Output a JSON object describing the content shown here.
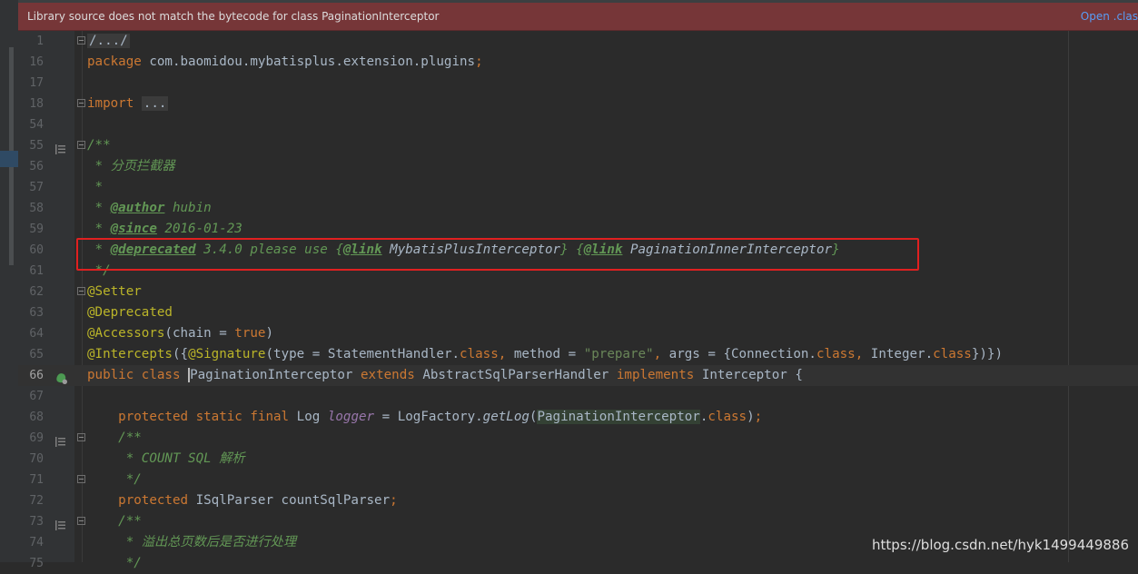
{
  "banner": {
    "message": "Library source does not match the bytecode for class PaginationInterceptor",
    "action": "Open .clas"
  },
  "lines": [
    {
      "num": "1",
      "fold": true,
      "text": "/.../"
    },
    {
      "num": "16",
      "text": "package com.baomidou.mybatisplus.extension.plugins;"
    },
    {
      "num": "17",
      "text": ""
    },
    {
      "num": "18",
      "fold": true,
      "text": "import ..."
    },
    {
      "num": "54",
      "text": ""
    },
    {
      "num": "55",
      "gutter": "doc-icon",
      "fold": true,
      "text": "/**"
    },
    {
      "num": "56",
      "text": " * 分页拦截器"
    },
    {
      "num": "57",
      "text": " *"
    },
    {
      "num": "58",
      "text": " * @author hubin"
    },
    {
      "num": "59",
      "text": " * @since 2016-01-23"
    },
    {
      "num": "60",
      "text": " * @deprecated 3.4.0 please use {@link MybatisPlusInterceptor} {@link PaginationInnerInterceptor}"
    },
    {
      "num": "61",
      "text": " */"
    },
    {
      "num": "62",
      "fold": true,
      "text": "@Setter"
    },
    {
      "num": "63",
      "text": "@Deprecated"
    },
    {
      "num": "64",
      "text": "@Accessors(chain = true)"
    },
    {
      "num": "65",
      "text": "@Intercepts({@Signature(type = StatementHandler.class, method = \"prepare\", args = {Connection.class, Integer.class})})"
    },
    {
      "num": "66",
      "gutter": "bean-icon",
      "current": true,
      "text": "public class PaginationInterceptor extends AbstractSqlParserHandler implements Interceptor {"
    },
    {
      "num": "67",
      "text": ""
    },
    {
      "num": "68",
      "text": "    protected static final Log logger = LogFactory.getLog(PaginationInterceptor.class);"
    },
    {
      "num": "69",
      "gutter": "doc-icon",
      "fold": true,
      "text": "    /**"
    },
    {
      "num": "70",
      "text": "     * COUNT SQL 解析"
    },
    {
      "num": "71",
      "fold": true,
      "text": "     */"
    },
    {
      "num": "72",
      "text": "    protected ISqlParser countSqlParser;"
    },
    {
      "num": "73",
      "gutter": "doc-icon",
      "fold": true,
      "text": "    /**"
    },
    {
      "num": "74",
      "text": "     * 溢出总页数后是否进行处理"
    },
    {
      "num": "75",
      "text": "     */"
    }
  ],
  "watermark": "https://blog.csdn.net/hyk1499449886",
  "colors": {
    "background": "#2b2b2b",
    "keyword": "#cc7832",
    "string": "#6a8759",
    "doc_comment": "#629755",
    "annotation": "#bbb529",
    "static_field": "#9876aa",
    "text": "#a9b7c6",
    "banner": "#763638",
    "highlight_box": "#e02020"
  }
}
